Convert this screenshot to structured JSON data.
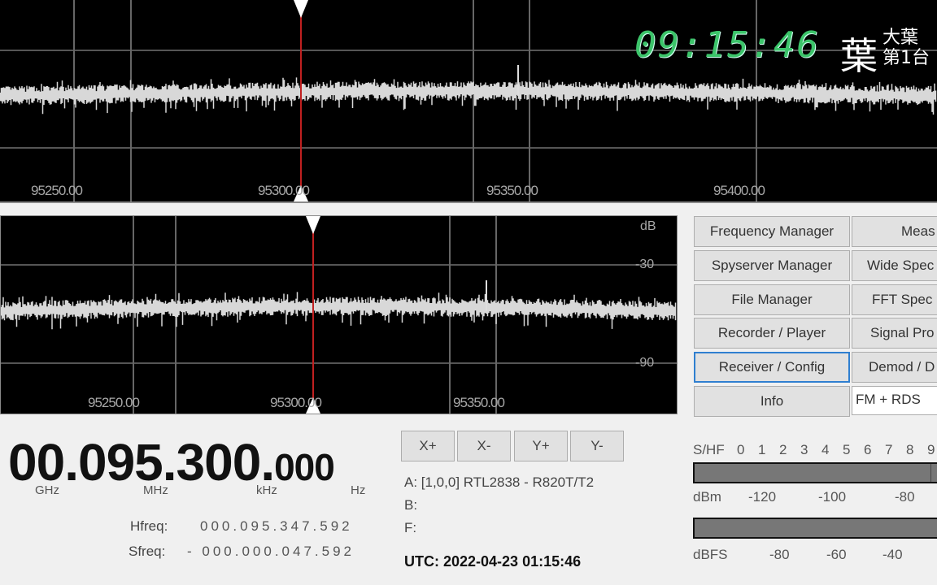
{
  "top_spectrum": {
    "freq_labels": [
      "95250.00",
      "95300.00",
      "95350.00",
      "95400.00"
    ],
    "trace_color": "#d8d8d8",
    "marker_color": "#c02020"
  },
  "bottom_spectrum": {
    "freq_labels": [
      "95250.00",
      "95300.00",
      "95350.00"
    ],
    "db_unit": "dB",
    "db_labels": [
      "-30",
      "-90"
    ]
  },
  "overlay": {
    "clock": "09:15:46",
    "logo_char": "葉",
    "logo_line1": "大葉",
    "logo_line2": "第1台",
    "clock_color": "#3cc46a"
  },
  "buttons": {
    "left": [
      "Frequency Manager",
      "Spyserver Manager",
      "File Manager",
      "Recorder / Player",
      "Receiver / Config",
      "Info"
    ],
    "right": [
      "Meas",
      "Wide Spec",
      "FFT Spec",
      "Signal Pro",
      "Demod / D"
    ],
    "selected": "Receiver / Config",
    "mode_value": "FM + RDS"
  },
  "frequency": {
    "ghz": "00",
    "mhz": "095",
    "khz": "300",
    "hz": "000",
    "units": [
      "GHz",
      "MHz",
      "kHz",
      "Hz"
    ],
    "hfreq_label": "Hfreq:",
    "hfreq": "000.095.347.592",
    "sfreq_label": "Sfreq:",
    "sfreq": "- 000.000.047.592"
  },
  "zoom": [
    "X+",
    "X-",
    "Y+",
    "Y-"
  ],
  "devices": {
    "a": "A: [1,0,0] RTL2838 - R820T/T2",
    "b": "B:",
    "f": "F:"
  },
  "utc": "UTC: 2022-04-23  01:15:46",
  "meters": {
    "s_label": "S/HF",
    "s_ticks": [
      "0",
      "1",
      "2",
      "3",
      "4",
      "5",
      "6",
      "7",
      "8",
      "9"
    ],
    "dbm_label": "dBm",
    "dbm_ticks": [
      "-120",
      "-100",
      "-80"
    ],
    "dbfs_label": "dBFS",
    "dbfs_ticks": [
      "-80",
      "-60",
      "-40"
    ]
  }
}
